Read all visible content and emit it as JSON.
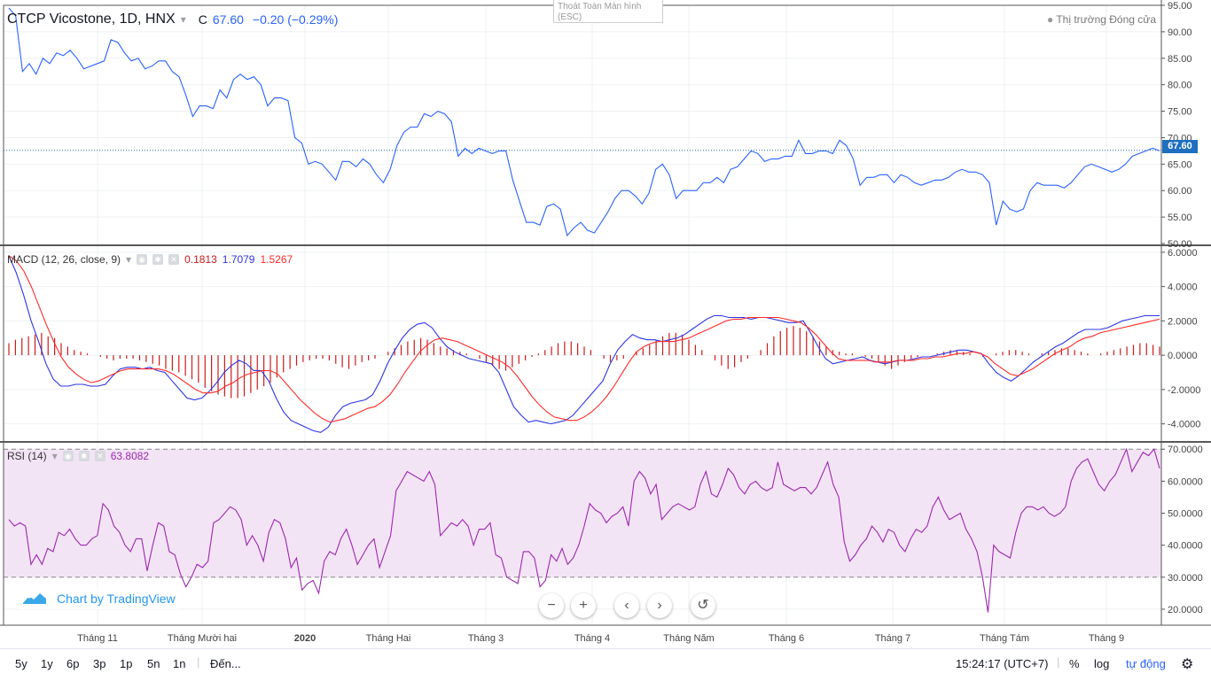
{
  "header": {
    "symbol": "CTCP Vicostone, 1D, HNX",
    "close_label": "C",
    "close_value": "67.60",
    "change": "−0.20 (−0.29%)",
    "market_status": "Thị trường Đóng cửa"
  },
  "exit_fullscreen": {
    "line1": "Thoát Toàn Màn hình",
    "line2": "(ESC)"
  },
  "macd_legend": {
    "label": "MACD (12, 26, close, 9)",
    "hist": "0.1813",
    "macd": "1.7079",
    "signal": "1.5267"
  },
  "rsi_legend": {
    "label": "RSI (14)",
    "value": "63.8082"
  },
  "brand": {
    "text": "Chart by TradingView"
  },
  "bottom": {
    "ranges": [
      "5y",
      "1y",
      "6p",
      "3p",
      "1p",
      "5n",
      "1n"
    ],
    "goto": "Đến...",
    "time": "15:24:17 (UTC+7)",
    "percent": "%",
    "log": "log",
    "auto": "tự động"
  },
  "colors": {
    "price": "#2962ff",
    "macd": "#2c35e5",
    "signal": "#ff2a2a",
    "hist": "#cc1a1a",
    "rsi": "#9c27b0",
    "rsi_band": "#f3e4f5",
    "last_price": "#1e6fbf"
  },
  "chart_data": [
    {
      "type": "line",
      "title": "CTCP Vicostone, 1D, HNX",
      "ylim": [
        49,
        95
      ],
      "yticks": [
        50,
        55,
        60,
        65,
        70,
        75,
        80,
        85,
        90,
        95
      ],
      "xticks": [
        "Tháng 11",
        "Tháng Mười hai",
        "2020",
        "Tháng Hai",
        "Tháng 3",
        "Tháng 4",
        "Tháng Năm",
        "Tháng 6",
        "Tháng 7",
        "Tháng Tám",
        "Tháng 9"
      ],
      "last_price": 67.6,
      "series": [
        {
          "name": "",
          "values": [
            94.5,
            93,
            82.5,
            84,
            82,
            85,
            84,
            86,
            85.5,
            86.5,
            85,
            83,
            83.5,
            84,
            84.5,
            88.5,
            88,
            86,
            84.5,
            85,
            83,
            83.5,
            84.5,
            84.5,
            82.5,
            81.5,
            78,
            74,
            76,
            76,
            75.5,
            79,
            77.5,
            81,
            82,
            81,
            81.5,
            80,
            76,
            77.5,
            77.5,
            77,
            70,
            69,
            65,
            65.5,
            65,
            63.5,
            62,
            65.5,
            65.5,
            64.5,
            66,
            65,
            63,
            61.5,
            64,
            68.5,
            71,
            72,
            72,
            74.5,
            74,
            75,
            74.5,
            73,
            66.5,
            68,
            67,
            68,
            67.5,
            67,
            67.5,
            67.5,
            62,
            58,
            54,
            54,
            53.5,
            57,
            57.5,
            56.5,
            51.5,
            53,
            54,
            52.5,
            52,
            54,
            56,
            58.5,
            60,
            60,
            59,
            57.5,
            59.5,
            64,
            65,
            63,
            58.5,
            60,
            60,
            60,
            61.5,
            61.5,
            62.5,
            61.5,
            64,
            64.5,
            66,
            67.5,
            67,
            65.5,
            66,
            66,
            66.5,
            66.5,
            69.5,
            67,
            67,
            67.5,
            67.5,
            67,
            69.5,
            68.5,
            66,
            61,
            62.5,
            62.5,
            63,
            63,
            61.5,
            63,
            62.5,
            61.5,
            61,
            61.5,
            62,
            62,
            62.5,
            63.5,
            64,
            63.5,
            63.5,
            63,
            61.5,
            53.5,
            58,
            56.5,
            56,
            56.5,
            60,
            61.5,
            61,
            61,
            61,
            60.5,
            61.5,
            63,
            64.5,
            65,
            64.5,
            64,
            63.5,
            64,
            65,
            66.5,
            67,
            67.5,
            68,
            67.5
          ]
        }
      ]
    },
    {
      "type": "line",
      "title": "MACD (12, 26, close, 9)",
      "ylim": [
        -5,
        6.3
      ],
      "yticks": [
        6,
        4,
        2,
        0,
        -2,
        -4
      ],
      "series": [
        {
          "name": "Histogram",
          "values": [
            0.7,
            0.9,
            1.0,
            1.1,
            1.2,
            1.3,
            1.1,
            1.0,
            0.7,
            0.5,
            0.3,
            0.2,
            0.1,
            0.0,
            -0.1,
            -0.2,
            -0.3,
            -0.2,
            -0.2,
            -0.2,
            -0.3,
            -0.4,
            -0.5,
            -0.6,
            -0.8,
            -0.9,
            -1.0,
            -1.2,
            -1.4,
            -1.6,
            -1.9,
            -2.1,
            -2.3,
            -2.4,
            -2.5,
            -2.5,
            -2.4,
            -2.2,
            -2.0,
            -1.8,
            -1.6,
            -1.3,
            -1.0,
            -0.8,
            -0.6,
            -0.4,
            -0.3,
            -0.2,
            -0.2,
            -0.3,
            -0.5,
            -0.7,
            -0.8,
            -0.6,
            -0.4,
            -0.3,
            -0.2,
            0.0,
            0.2,
            0.4,
            0.6,
            0.8,
            0.9,
            1.0,
            0.9,
            0.7,
            0.5,
            0.4,
            0.3,
            0.2,
            0.1,
            0.0,
            -0.2,
            -0.4,
            -0.6,
            -0.8,
            -0.9,
            -0.7,
            -0.5,
            -0.3,
            -0.1,
            0.1,
            0.3,
            0.5,
            0.7,
            0.8,
            0.8,
            0.7,
            0.5,
            0.3,
            0.0,
            -0.2,
            -0.4,
            -0.3,
            -0.2,
            0.0,
            0.2,
            0.4,
            0.6,
            0.9,
            1.1,
            1.3,
            1.3,
            1.2,
            0.9,
            0.6,
            0.3,
            0.0,
            -0.3,
            -0.6,
            -0.8,
            -0.7,
            -0.4,
            -0.2,
            0.0,
            0.3,
            0.7,
            1.1,
            1.4,
            1.6,
            1.7,
            1.6,
            1.4,
            1.1,
            0.8,
            0.5,
            0.3,
            0.2,
            0.1,
            0.1,
            0.0,
            -0.1,
            -0.2,
            -0.4,
            -0.6,
            -0.8,
            -0.6,
            -0.4,
            -0.2,
            -0.1,
            0.0,
            0.0,
            0.1,
            0.2,
            0.3,
            0.3,
            0.2,
            0.1,
            0.0,
            -0.1,
            0.0,
            0.1,
            0.2,
            0.3,
            0.3,
            0.2,
            0.1,
            0.0,
            0.1,
            0.2,
            0.3,
            0.4,
            0.4,
            0.3,
            0.2,
            0.1,
            0.0,
            0.1,
            0.2,
            0.3,
            0.4,
            0.5,
            0.6,
            0.7,
            0.7,
            0.6,
            0.5
          ]
        },
        {
          "name": "MACD",
          "values": [
            5.8,
            4.8,
            3.5,
            2.0,
            0.8,
            -0.5,
            -1.4,
            -1.8,
            -1.8,
            -1.7,
            -1.7,
            -1.8,
            -1.8,
            -1.7,
            -1.2,
            -0.8,
            -0.7,
            -0.7,
            -0.8,
            -0.7,
            -0.9,
            -1.0,
            -1.5,
            -2.0,
            -2.5,
            -2.6,
            -2.5,
            -2.1,
            -1.6,
            -1.0,
            -0.6,
            -0.3,
            -0.5,
            -0.9,
            -0.9,
            -1.5,
            -2.5,
            -3.3,
            -3.8,
            -4.0,
            -4.2,
            -4.4,
            -4.5,
            -4.2,
            -3.5,
            -3.0,
            -2.8,
            -2.7,
            -2.6,
            -2.3,
            -1.5,
            -0.5,
            0.3,
            1.0,
            1.5,
            1.8,
            1.9,
            1.6,
            1.0,
            0.5,
            0.2,
            0.0,
            -0.2,
            -0.3,
            -0.4,
            -0.5,
            -1.0,
            -2.0,
            -3.0,
            -3.5,
            -3.9,
            -3.8,
            -3.9,
            -4.0,
            -3.9,
            -3.8,
            -3.5,
            -3.0,
            -2.5,
            -2.0,
            -1.5,
            -0.5,
            0.3,
            0.8,
            1.2,
            1.0,
            0.9,
            0.9,
            0.8,
            0.9,
            1.0,
            1.2,
            1.5,
            1.8,
            2.1,
            2.3,
            2.3,
            2.2,
            2.2,
            2.2,
            2.1,
            2.2,
            2.2,
            2.1,
            2.0,
            1.9,
            1.9,
            2.0,
            1.3,
            0.5,
            -0.2,
            -0.5,
            -0.4,
            -0.3,
            -0.2,
            -0.1,
            -0.3,
            -0.4,
            -0.5,
            -0.4,
            -0.3,
            -0.3,
            -0.2,
            -0.1,
            -0.1,
            0.0,
            0.1,
            0.2,
            0.3,
            0.3,
            0.2,
            0.1,
            -0.5,
            -1.0,
            -1.3,
            -1.5,
            -1.2,
            -0.8,
            -0.4,
            -0.1,
            0.2,
            0.5,
            0.7,
            1.0,
            1.3,
            1.5,
            1.5,
            1.5,
            1.6,
            1.8,
            2.0,
            2.1,
            2.2,
            2.3,
            2.3,
            2.3
          ]
        },
        {
          "name": "Signal",
          "values": [
            5.8,
            5.5,
            4.9,
            4.0,
            2.9,
            1.8,
            0.8,
            -0.1,
            -0.7,
            -1.1,
            -1.4,
            -1.6,
            -1.5,
            -1.3,
            -1.1,
            -0.9,
            -0.8,
            -0.8,
            -0.8,
            -0.8,
            -0.8,
            -0.9,
            -1.1,
            -1.4,
            -1.7,
            -2.0,
            -2.2,
            -2.2,
            -2.1,
            -1.8,
            -1.6,
            -1.3,
            -1.1,
            -1.0,
            -0.9,
            -0.9,
            -1.1,
            -1.6,
            -2.1,
            -2.6,
            -3.0,
            -3.4,
            -3.7,
            -3.9,
            -3.8,
            -3.7,
            -3.5,
            -3.3,
            -3.1,
            -3.0,
            -2.7,
            -2.3,
            -1.7,
            -1.0,
            -0.4,
            0.2,
            0.6,
            0.9,
            1.0,
            0.9,
            0.8,
            0.6,
            0.4,
            0.2,
            0.0,
            -0.2,
            -0.4,
            -0.7,
            -1.2,
            -1.8,
            -2.4,
            -2.9,
            -3.3,
            -3.6,
            -3.7,
            -3.8,
            -3.8,
            -3.6,
            -3.3,
            -2.9,
            -2.4,
            -1.8,
            -1.1,
            -0.4,
            0.2,
            0.5,
            0.7,
            0.8,
            0.8,
            0.8,
            0.9,
            1.0,
            1.2,
            1.4,
            1.6,
            1.8,
            2.0,
            2.1,
            2.1,
            2.2,
            2.2,
            2.2,
            2.2,
            2.2,
            2.1,
            2.0,
            1.9,
            1.6,
            1.2,
            0.7,
            0.2,
            -0.2,
            -0.3,
            -0.3,
            -0.3,
            -0.3,
            -0.4,
            -0.4,
            -0.4,
            -0.3,
            -0.3,
            -0.3,
            -0.2,
            -0.2,
            -0.1,
            -0.1,
            0.0,
            0.1,
            0.1,
            0.2,
            0.1,
            -0.1,
            -0.5,
            -0.8,
            -1.1,
            -1.2,
            -1.0,
            -0.8,
            -0.5,
            -0.2,
            0.1,
            0.3,
            0.5,
            0.8,
            1.0,
            1.1,
            1.3,
            1.4,
            1.5,
            1.6,
            1.7,
            1.8,
            1.9,
            2.0,
            2.1
          ]
        }
      ]
    },
    {
      "type": "line",
      "title": "RSI (14)",
      "ylim": [
        15,
        72
      ],
      "yticks": [
        70,
        60,
        50,
        40,
        30,
        20
      ],
      "band": [
        30,
        70
      ],
      "series": [
        {
          "name": "RSI",
          "values": [
            48,
            46,
            47,
            46,
            34,
            37,
            34,
            39,
            38,
            44,
            43,
            45,
            42,
            40,
            40,
            42,
            43,
            53,
            51,
            46,
            44,
            40,
            38,
            42,
            42,
            32,
            40,
            47,
            46,
            38,
            37,
            31,
            27,
            30,
            34,
            33,
            35,
            47,
            48,
            50,
            52,
            51,
            48,
            40,
            43,
            40,
            35,
            44,
            48,
            47,
            42,
            33,
            36,
            26,
            28,
            29,
            25,
            35,
            38,
            37,
            42,
            45,
            40,
            34,
            37,
            40,
            42,
            33,
            38,
            43,
            57,
            60,
            63,
            62,
            61,
            60,
            63,
            59,
            43,
            45,
            47,
            46,
            48,
            46,
            40,
            45,
            45,
            47,
            37,
            36,
            30,
            29,
            28,
            38,
            38,
            36,
            27,
            29,
            37,
            35,
            39,
            34,
            36,
            40,
            46,
            53,
            51,
            50,
            47,
            49,
            50,
            52,
            46,
            60,
            63,
            61,
            56,
            59,
            48,
            50,
            52,
            53,
            52,
            51,
            52,
            59,
            63,
            56,
            55,
            59,
            64,
            62,
            58,
            56,
            59,
            60,
            58,
            57,
            58,
            66,
            59,
            58,
            57,
            58,
            58,
            56,
            58,
            62,
            66,
            59,
            55,
            41,
            35,
            37,
            40,
            42,
            46,
            44,
            41,
            45,
            44,
            40,
            38,
            42,
            45,
            44,
            46,
            52,
            55,
            51,
            48,
            49,
            50,
            45,
            42,
            38,
            30,
            19,
            40,
            38,
            37,
            36,
            44,
            50,
            52,
            52,
            51,
            52,
            50,
            49,
            50,
            52,
            60,
            64,
            66,
            67,
            63,
            59,
            57,
            60,
            62,
            66,
            70,
            63,
            66,
            69,
            68,
            70,
            64
          ]
        }
      ]
    }
  ]
}
